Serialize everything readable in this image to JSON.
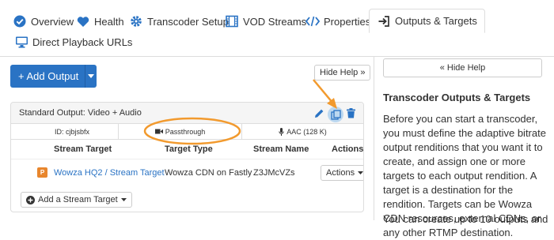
{
  "tabs": [
    {
      "label": "Overview",
      "icon": "check-circle-icon"
    },
    {
      "label": "Health",
      "icon": "heart-icon"
    },
    {
      "label": "Transcoder Setup",
      "icon": "gear-icon"
    },
    {
      "label": "VOD Streams",
      "icon": "film-icon"
    },
    {
      "label": "Properties",
      "icon": "code-icon"
    },
    {
      "label": "Outputs & Targets",
      "icon": "sign-in-icon",
      "active": true
    },
    {
      "label": "Direct Playback URLs",
      "icon": "monitor-icon"
    }
  ],
  "toolbar": {
    "add_output_label": "+ Add Output",
    "hide_help_label": "Hide Help »"
  },
  "output": {
    "title": "Standard Output: Video + Audio",
    "id_text": "ID: cjbjsbfx",
    "video_text": "Passthrough",
    "audio_text": "AAC (128 K)",
    "columns": {
      "stream_target": "Stream Target",
      "target_type": "Target Type",
      "stream_name": "Stream Name",
      "actions": "Actions"
    },
    "rows": [
      {
        "badge": "P",
        "stream_target": "Wowza HQ2 / Stream Target",
        "target_type": "Wowza CDN on Fastly",
        "stream_name": "Z3JMcVZs",
        "actions_label": "Actions"
      }
    ],
    "add_target_label": "Add a Stream Target"
  },
  "help": {
    "hide_button_label": "« Hide Help",
    "title": "Transcoder Outputs & Targets",
    "paragraph_1": "Before you can start a transcoder, you must define the adaptive bitrate output renditions that you want it to create, and assign one or more targets to each output rendition. A target is a destination for the rendition. Targets can be Wowza CDN resources, external CDNs, or any other RTMP destination.",
    "paragraph_2": "You can create up to 10 outputs and as"
  },
  "colors": {
    "primary": "#2a73c4",
    "annotation_orange": "#f29a2e",
    "badge_orange": "#e8862d"
  }
}
